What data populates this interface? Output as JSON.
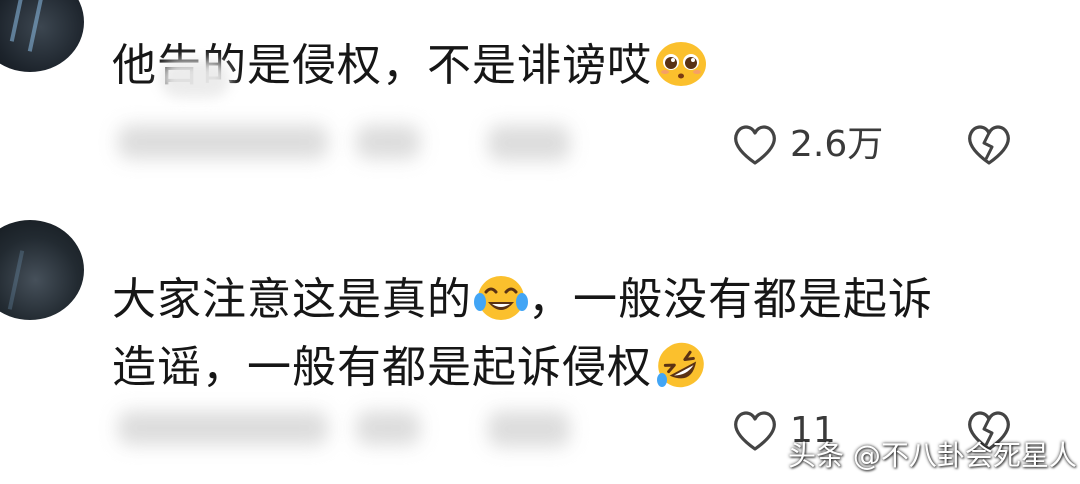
{
  "comments": [
    {
      "lines": [
        "他告的是侵权，不是诽谤哎"
      ],
      "emoji": "pleading-face-emoji",
      "like_count": "2.6万"
    },
    {
      "lines": [
        "大家注意这是真的",
        "，一般没有都是起诉",
        "造谣，一般有都是起诉侵权"
      ],
      "emojis": [
        "tears-of-joy-emoji",
        "rolling-laughing-emoji"
      ],
      "like_count": "11"
    }
  ],
  "watermark": "头条 @不八卦会死星人",
  "colors": {
    "text": "#161616",
    "meta_text": "#3a3a3a",
    "icon_stroke": "#444444",
    "emoji_yellow": "#fbc02d"
  },
  "icons": [
    "heart-outline-icon",
    "broken-heart-icon"
  ]
}
